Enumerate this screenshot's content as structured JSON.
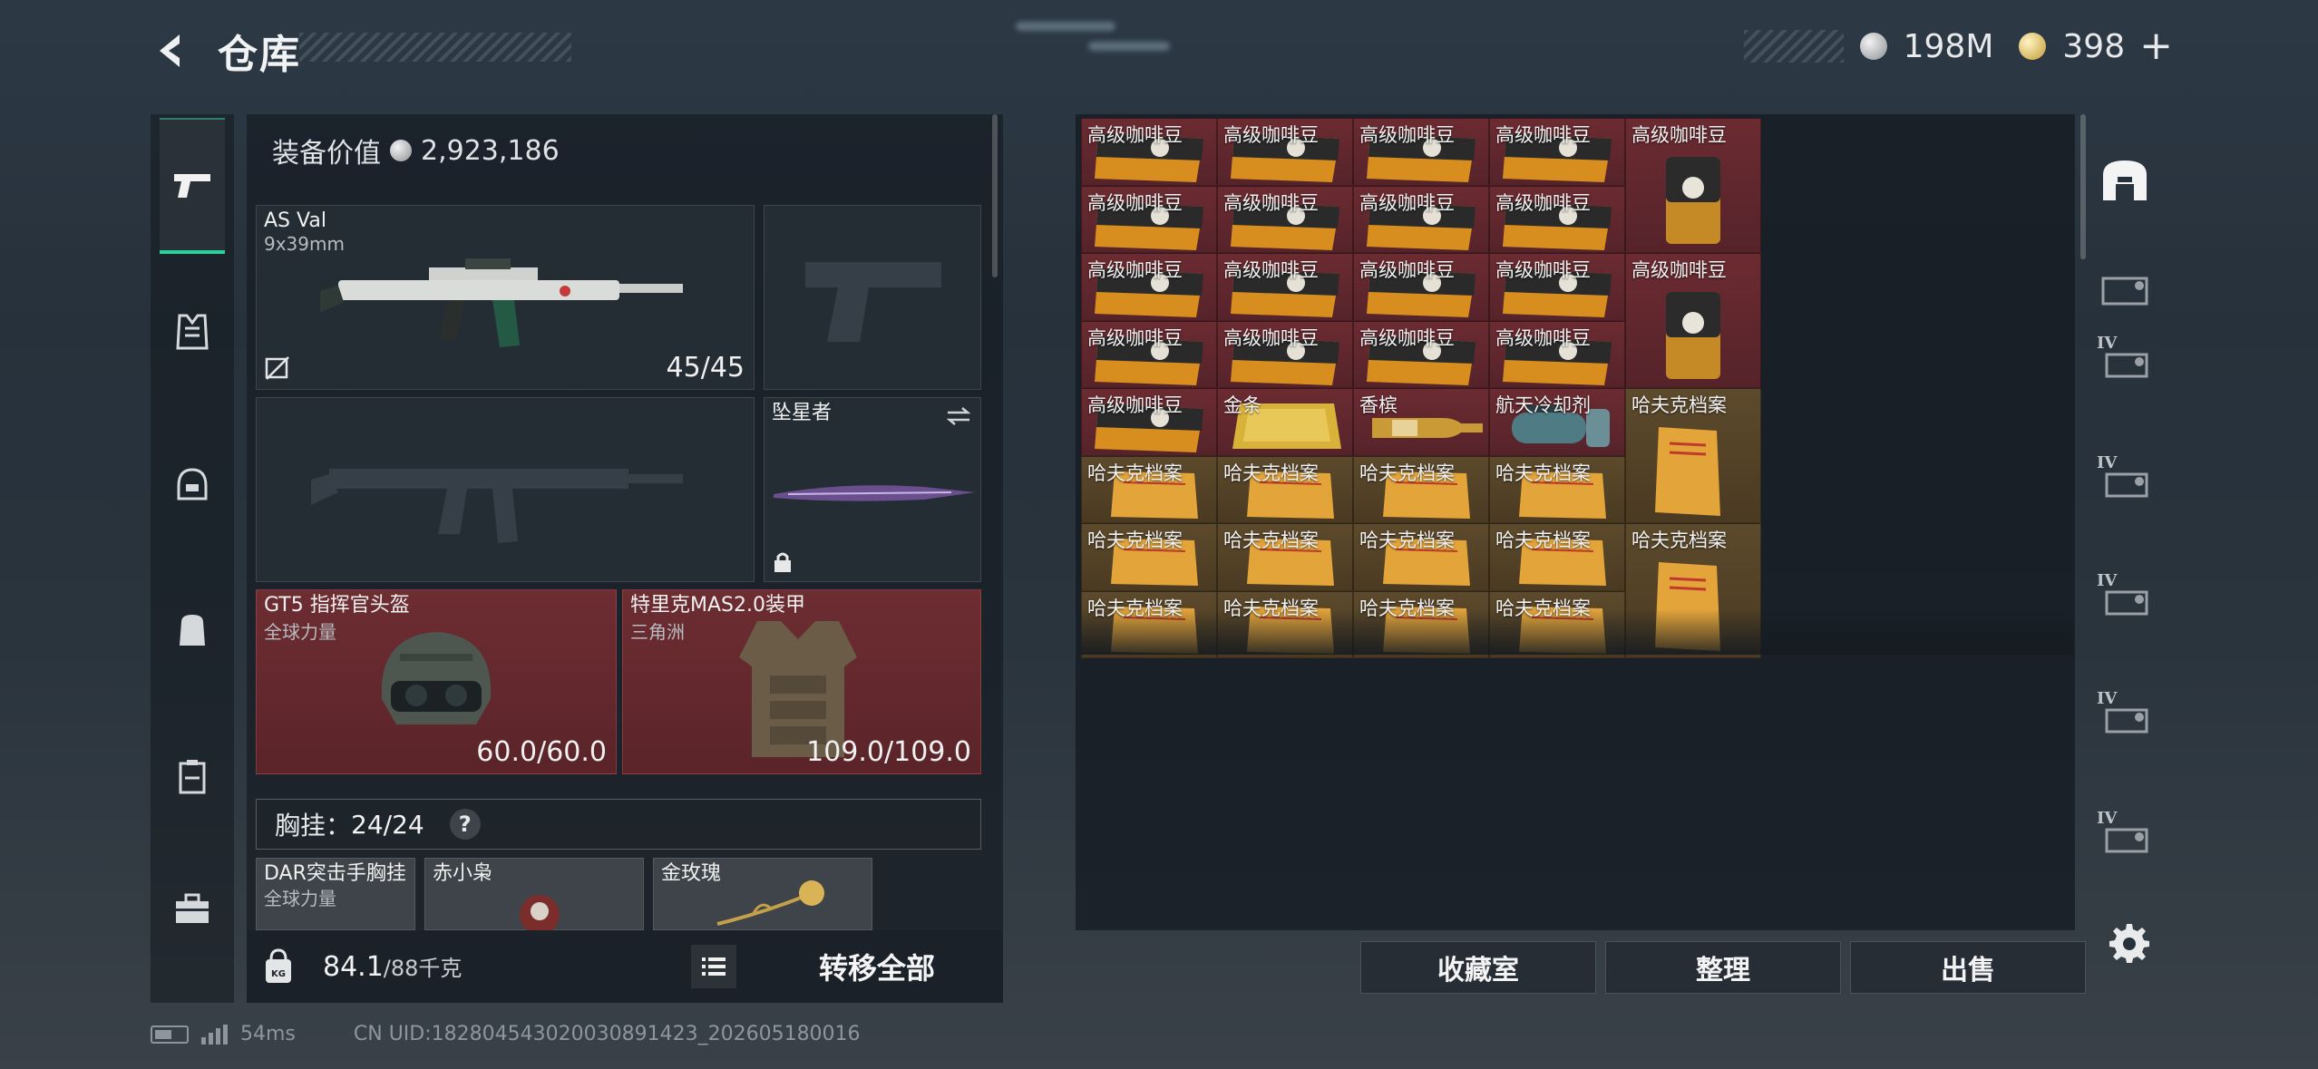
{
  "header": {
    "title": "仓库",
    "currencies": [
      {
        "icon": "silver-coin-icon",
        "value": "198M"
      },
      {
        "icon": "gold-coin-icon",
        "value": "398"
      }
    ],
    "plus_label": "+"
  },
  "rail": {
    "items": [
      "weapon-icon",
      "vest-icon",
      "helmet-icon",
      "backpack-icon",
      "case-icon",
      "toolbox-icon"
    ]
  },
  "loadout": {
    "equipment_value_label": "装备价值",
    "equipment_value": "2,923,186",
    "primary_weapon": {
      "name": "AS Val",
      "caliber": "9x39mm",
      "ammo": "45/45"
    },
    "melee": {
      "name": "坠星者"
    },
    "helmet": {
      "name": "GT5 指挥官头盔",
      "sub": "全球力量",
      "durability": "60.0/60.0"
    },
    "armor": {
      "name": "特里克MAS2.0装甲",
      "sub": "三角洲",
      "durability": "109.0/109.0"
    },
    "chest_rig": {
      "label": "胸挂：",
      "count": "24/24",
      "help": "?"
    },
    "chest_items": [
      {
        "name": "DAR突击手胸挂",
        "sub": "全球力量"
      },
      {
        "name": "赤小枭",
        "sub": ""
      },
      {
        "name": "金玫瑰",
        "sub": ""
      }
    ]
  },
  "weight": {
    "current": "84.1",
    "max": "/88千克"
  },
  "transfer_all": "转移全部",
  "storage": {
    "rows": [
      [
        "高级咖啡豆",
        "高级咖啡豆",
        "高级咖啡豆",
        "高级咖啡豆",
        "高级咖啡豆"
      ],
      [
        "高级咖啡豆",
        "高级咖啡豆",
        "高级咖啡豆",
        "高级咖啡豆"
      ],
      [
        "高级咖啡豆",
        "高级咖啡豆",
        "高级咖啡豆",
        "高级咖啡豆",
        "高级咖啡豆"
      ],
      [
        "高级咖啡豆",
        "高级咖啡豆",
        "高级咖啡豆",
        "高级咖啡豆"
      ],
      [
        "高级咖啡豆",
        "金条",
        "香槟",
        "航天冷却剂",
        "哈夫克档案"
      ],
      [
        "哈夫克档案",
        "哈夫克档案",
        "哈夫克档案",
        "哈夫克档案"
      ],
      [
        "哈夫克档案",
        "哈夫克档案",
        "哈夫克档案",
        "哈夫克档案",
        "哈夫克档案"
      ],
      [
        "哈夫克档案",
        "哈夫克档案",
        "哈夫克档案",
        "哈夫克档案"
      ]
    ]
  },
  "actions": {
    "collection": "收藏室",
    "organize": "整理",
    "sell": "出售"
  },
  "side_tabs": {
    "levels": [
      "IV",
      "IV",
      "IV",
      "IV",
      "IV"
    ]
  },
  "status": {
    "ping": "54ms",
    "uid": "CN UID:182804543020030891423_202605180016"
  },
  "colors": {
    "accent": "#2fcf9b",
    "red_cell": "#6b2b31",
    "gold_cell": "#5d4a2c"
  }
}
